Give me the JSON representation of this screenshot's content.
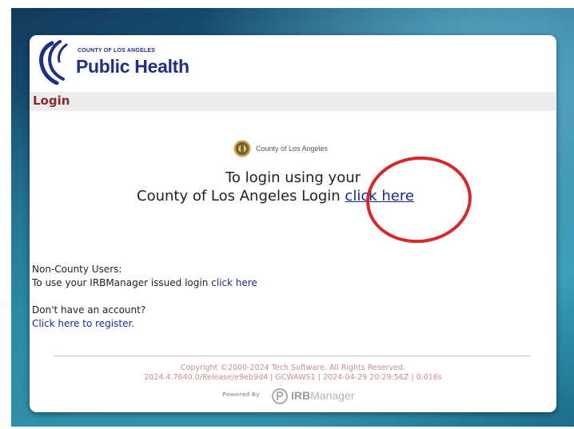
{
  "header": {
    "logo_small": "COUNTY OF LOS ANGELES",
    "logo_big": "Public Health"
  },
  "login_bar": {
    "title": "Login"
  },
  "county": {
    "seal_label": "County of Los Angeles",
    "line1": "To login using your",
    "line2": "County of Los Angeles Login",
    "link": "click here"
  },
  "non_county": {
    "heading": "Non-County Users:",
    "text": "To use your IRBManager issued login",
    "link": "click here"
  },
  "account": {
    "question": "Don't have an account?",
    "register_link": "Click here to register."
  },
  "footer": {
    "copyright": "Copyright ©2000-2024 Tech Software. All Rights Reserved.",
    "build": "2024.4.7640.0/Release/e9eb9d4 | GCWAWS1 | 2024-04-29 20:29:56Z | 0.016s",
    "powered_by": "Powered By",
    "brand_bold": "IRB",
    "brand_rest": "Manager"
  },
  "colors": {
    "brand_blue": "#1e2f86",
    "login_title": "#8a2a2a",
    "link": "#1a2a9a",
    "annotation_circle": "#d62828"
  }
}
